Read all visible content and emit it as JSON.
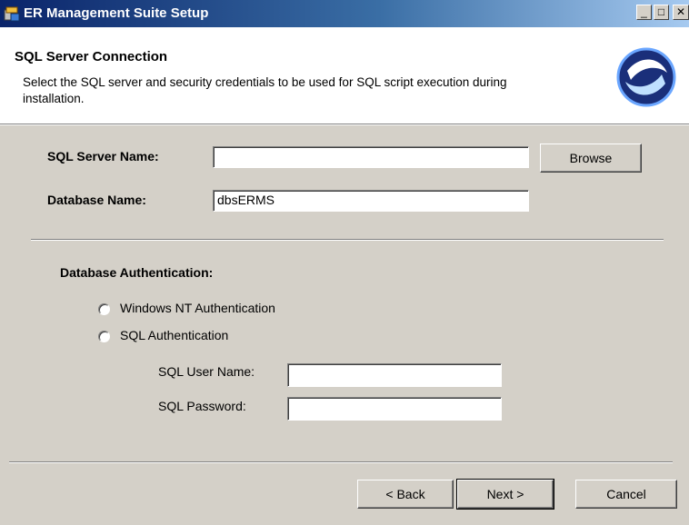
{
  "window": {
    "title": "ER Management Suite Setup",
    "icon": "installer-icon",
    "minimize": "_",
    "maximize": "□",
    "close": "✕"
  },
  "header": {
    "title": "SQL Server Connection",
    "description": "Select the SQL server and security credentials to be used for SQL script execution during installation.",
    "logo": "swirl-logo-icon"
  },
  "form": {
    "server_label": "SQL Server Name:",
    "server_value": "",
    "browse_label": "Browse",
    "db_label": "Database Name:",
    "db_value": "dbsERMS",
    "auth_label": "Database Authentication:",
    "auth_options": [
      "Windows NT Authentication",
      "SQL Authentication"
    ],
    "auth_selected": "",
    "user_label": "SQL User Name:",
    "user_value": "",
    "password_label": "SQL Password:",
    "password_value": ""
  },
  "footer": {
    "back_label": "< Back",
    "next_label": "Next >",
    "cancel_label": "Cancel"
  }
}
